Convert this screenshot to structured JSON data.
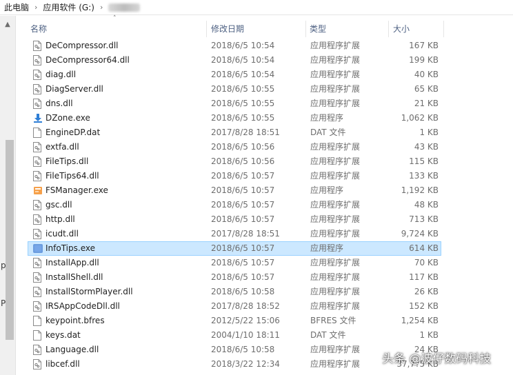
{
  "breadcrumb": {
    "computer": "此电脑",
    "drive": "应用软件 (G:)"
  },
  "columns": {
    "name": "名称",
    "date": "修改日期",
    "type": "类型",
    "size": "大小"
  },
  "files": [
    {
      "name": "DeCompressor.dll",
      "date": "2018/6/5 10:54",
      "type": "应用程序扩展",
      "size": "167 KB",
      "icon": "dll-file-icon"
    },
    {
      "name": "DeCompressor64.dll",
      "date": "2018/6/5 10:54",
      "type": "应用程序扩展",
      "size": "199 KB",
      "icon": "dll-file-icon"
    },
    {
      "name": "diag.dll",
      "date": "2018/6/5 10:54",
      "type": "应用程序扩展",
      "size": "40 KB",
      "icon": "dll-file-icon"
    },
    {
      "name": "DiagServer.dll",
      "date": "2018/6/5 10:55",
      "type": "应用程序扩展",
      "size": "65 KB",
      "icon": "dll-file-icon"
    },
    {
      "name": "dns.dll",
      "date": "2018/6/5 10:55",
      "type": "应用程序扩展",
      "size": "21 KB",
      "icon": "dll-file-icon"
    },
    {
      "name": "DZone.exe",
      "date": "2018/6/5 10:55",
      "type": "应用程序",
      "size": "1,062 KB",
      "icon": "download-exe-icon"
    },
    {
      "name": "EngineDP.dat",
      "date": "2017/8/28 18:51",
      "type": "DAT 文件",
      "size": "1 KB",
      "icon": "blank-file-icon"
    },
    {
      "name": "extfa.dll",
      "date": "2018/6/5 10:56",
      "type": "应用程序扩展",
      "size": "43 KB",
      "icon": "dll-file-icon"
    },
    {
      "name": "FileTips.dll",
      "date": "2018/6/5 10:56",
      "type": "应用程序扩展",
      "size": "115 KB",
      "icon": "dll-file-icon"
    },
    {
      "name": "FileTips64.dll",
      "date": "2018/6/5 10:57",
      "type": "应用程序扩展",
      "size": "133 KB",
      "icon": "dll-file-icon"
    },
    {
      "name": "FSManager.exe",
      "date": "2018/6/5 10:57",
      "type": "应用程序",
      "size": "1,192 KB",
      "icon": "app-exe-icon"
    },
    {
      "name": "gsc.dll",
      "date": "2018/6/5 10:57",
      "type": "应用程序扩展",
      "size": "48 KB",
      "icon": "dll-file-icon"
    },
    {
      "name": "http.dll",
      "date": "2018/6/5 10:57",
      "type": "应用程序扩展",
      "size": "713 KB",
      "icon": "dll-file-icon"
    },
    {
      "name": "icudt.dll",
      "date": "2017/8/28 18:51",
      "type": "应用程序扩展",
      "size": "9,724 KB",
      "icon": "dll-file-icon"
    },
    {
      "name": "InfoTips.exe",
      "date": "2018/6/5 10:57",
      "type": "应用程序",
      "size": "614 KB",
      "icon": "blurred-exe-icon",
      "selected": true
    },
    {
      "name": "InstallApp.dll",
      "date": "2018/6/5 10:57",
      "type": "应用程序扩展",
      "size": "70 KB",
      "icon": "dll-file-icon"
    },
    {
      "name": "InstallShell.dll",
      "date": "2018/6/5 10:57",
      "type": "应用程序扩展",
      "size": "117 KB",
      "icon": "dll-file-icon"
    },
    {
      "name": "InstallStormPlayer.dll",
      "date": "2018/6/5 10:58",
      "type": "应用程序扩展",
      "size": "26 KB",
      "icon": "dll-file-icon"
    },
    {
      "name": "IRSAppCodeDll.dll",
      "date": "2017/8/28 18:52",
      "type": "应用程序扩展",
      "size": "152 KB",
      "icon": "dll-file-icon"
    },
    {
      "name": "keypoint.bfres",
      "date": "2012/5/22 15:06",
      "type": "BFRES 文件",
      "size": "1,254 KB",
      "icon": "blank-file-icon"
    },
    {
      "name": "keys.dat",
      "date": "2004/1/10 18:11",
      "type": "DAT 文件",
      "size": "1 KB",
      "icon": "blank-file-icon"
    },
    {
      "name": "Language.dll",
      "date": "2018/6/5 10:58",
      "type": "应用程序扩展",
      "size": "24 KB",
      "icon": "dll-file-icon"
    },
    {
      "name": "libcef.dll",
      "date": "2018/3/22 12:34",
      "type": "应用程序扩展",
      "size": "37,7?5 KB",
      "icon": "dll-file-icon"
    }
  ],
  "left_pane_glyphs": [
    "p",
    "P"
  ],
  "watermark": "头条 @波仔数码科技",
  "colors": {
    "selected_bg": "#cce8ff",
    "header_text": "#4d6082",
    "secondary_text": "#6d6d6d"
  }
}
